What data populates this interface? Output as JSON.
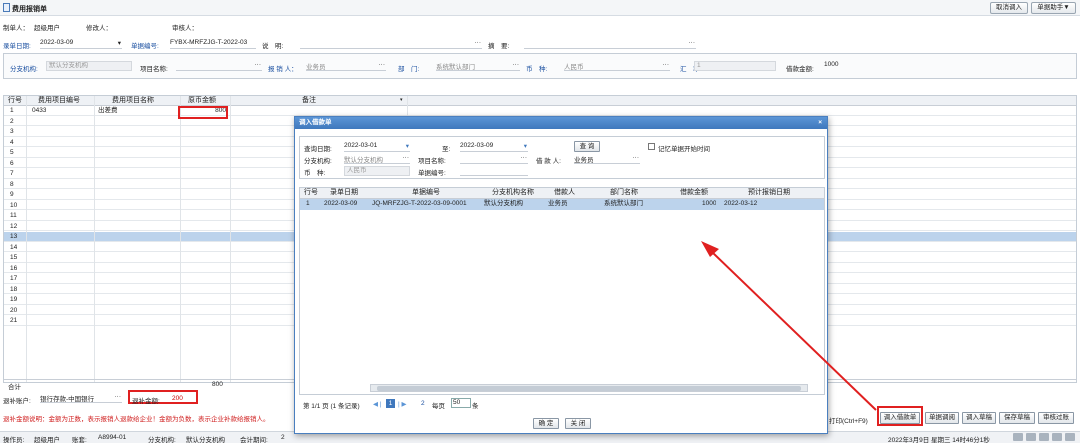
{
  "window": {
    "title": "费用报销单"
  },
  "toolbar": {
    "import_btn": "取消调入",
    "helper_btn": "单据助手▼"
  },
  "header_row1": {
    "creator_label": "制单人：",
    "creator_value": "超级用户",
    "modifier_label": "修改人：",
    "auditor_label": "审核人："
  },
  "header_row2": {
    "date_label": "录单日期:",
    "date_value": "2022-03-09",
    "docno_label": "单据编号:",
    "docno_value": "FYBX-MRFZJG-T-2022-03",
    "desc_label": "说　明:",
    "summary_label": "摘　要:",
    "dots": "···"
  },
  "header_row3": {
    "branch_label": "分支机构:",
    "branch_value": "默认分支机构",
    "project_label": "项目名称:",
    "reporter_label": "报 销 人：",
    "reporter_value": "业务员",
    "dept_label": "部　门:",
    "dept_value": "系统默认部门",
    "currency_label": "币　种:",
    "currency_value": "人民币",
    "rate_label": "汇　率:",
    "rate_value": "1",
    "loan_label": "借款金额:",
    "loan_value": "1000"
  },
  "grid": {
    "headers": [
      "行号",
      "费用项目编号",
      "费用项目名称",
      "原币金额",
      "备注"
    ],
    "rows": [
      [
        "1",
        "0433",
        "出差费",
        "800",
        ""
      ],
      [
        "2"
      ],
      [
        "3"
      ],
      [
        "4"
      ],
      [
        "5"
      ],
      [
        "6"
      ],
      [
        "7"
      ],
      [
        "8"
      ],
      [
        "9"
      ],
      [
        "10"
      ],
      [
        "11"
      ],
      [
        "12"
      ],
      [
        "13"
      ],
      [
        "14"
      ],
      [
        "15"
      ],
      [
        "16"
      ],
      [
        "17"
      ],
      [
        "18"
      ],
      [
        "19"
      ],
      [
        "20"
      ],
      [
        "21"
      ]
    ],
    "total_label": "合计",
    "total_value": "800"
  },
  "footer": {
    "account_label": "退补账户:",
    "account_value": "银行存款-中国银行",
    "refund_label": "退补金额:",
    "refund_value": "200",
    "note": "退补金额说明：金额为正数，表示报销人退款给企业！金额为负数，表示企业补款给报销人。"
  },
  "bottom_buttons": {
    "shortcut": "打印(Ctrl+F9)",
    "import_loan": "调入借款单",
    "doc_query": "单据调阅",
    "import_draft": "调入草稿",
    "save_draft": "保存草稿",
    "audit": "审核过账"
  },
  "status_bar": {
    "operator_label": "操作员:",
    "operator_value": "超级用户",
    "book_label": "账套:",
    "book_value": "A8994-01",
    "branch_label": "分支机构:",
    "branch_value": "默认分支机构",
    "period_label": "会计期间:",
    "period_value": "2",
    "datetime": "2022年3月9日 星期三 14时46分1秒"
  },
  "dialog": {
    "title": "调入借款单",
    "close": "×",
    "query_date_label": "查询日期:",
    "query_date_from": "2022-03-01",
    "to_label": "至:",
    "query_date_to": "2022-03-09",
    "query_btn": "查 询",
    "remember_label": "记忆单据开始时间",
    "branch_label": "分支机构:",
    "branch_value": "默认分支机构",
    "project_label": "项目名称:",
    "borrower_label": "借 款 人:",
    "borrower_value": "业务员",
    "currency_label": "币　种:",
    "currency_value": "人民币",
    "docno_label": "单据编号:",
    "table_headers": [
      "行号",
      "录单日期",
      "单据编号",
      "分支机构名称",
      "借款人",
      "部门名称",
      "借款金额",
      "预计报销日期"
    ],
    "table_rows": [
      [
        "1",
        "2022-03-09",
        "JQ-MRFZJG-T-2022-03-09-0001",
        "默认分支机构",
        "业务员",
        "系统默认部门",
        "1000",
        "2022-03-12"
      ]
    ],
    "pager": {
      "page_info": "第 1/1 页 (1 条记录)",
      "current_page": "1",
      "next_page": "2",
      "per_page_label": "每页",
      "per_page_value": "50",
      "unit": "条"
    },
    "ok_btn": "确 定",
    "cancel_btn": "关 闭"
  },
  "colors": {
    "accent": "#3f78bd",
    "highlight": "#e02020",
    "selected_row": "#bcd3ec"
  }
}
